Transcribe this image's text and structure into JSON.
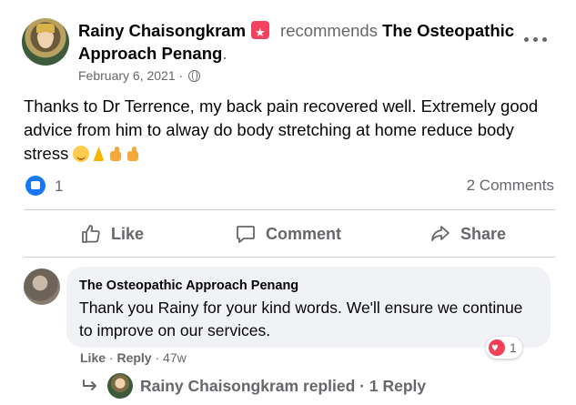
{
  "post": {
    "author": "Rainy Chaisongkram",
    "action_text": "recommends",
    "page_name": "The Osteopathic Approach Penang",
    "page_name_line1": "The Osteopathic",
    "page_name_line2": "Approach Penang",
    "trailing_period": ".",
    "date": "February 6, 2021",
    "date_separator": "·",
    "privacy_icon": "globe-icon",
    "more_icon": "more-options-icon",
    "text": "Thanks to Dr Terrence, my back pain recovered well. Extremely good advice from him to alway do body stretching at home reduce body stress",
    "emojis": [
      "grinning-face",
      "folded-hands",
      "thumbs-up",
      "thumbs-up"
    ]
  },
  "reactions": {
    "icon": "like-reaction-icon",
    "count": "1",
    "comments_label": "2 Comments"
  },
  "actions": {
    "like": "Like",
    "comment": "Comment",
    "share": "Share"
  },
  "comment": {
    "author": "The Osteopathic Approach Penang",
    "text": "Thank you Rainy for your kind words. We'll ensure we continue to improve on our services.",
    "like_label": "Like",
    "reply_label": "Reply",
    "separator": "·",
    "age": "47w",
    "reaction_icon": "heart-reaction-icon",
    "reaction_count": "1"
  },
  "reply_summary": {
    "text": "Rainy Chaisongkram replied · 1 Reply"
  },
  "colors": {
    "accent": "#1877f2",
    "recommend_badge": "#f3425f",
    "heart": "#f33e58",
    "muted_text": "#65676b",
    "bubble_bg": "#f0f2f5"
  }
}
